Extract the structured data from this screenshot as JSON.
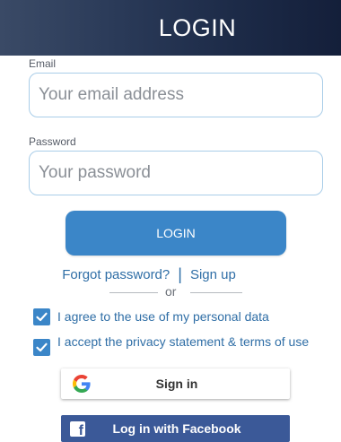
{
  "header": {
    "title": "LOGIN"
  },
  "email": {
    "label": "Email",
    "placeholder": "Your email address",
    "value": ""
  },
  "password": {
    "label": "Password",
    "placeholder": "Your password",
    "value": ""
  },
  "login_button": {
    "label": "LOGIN"
  },
  "links": {
    "forgot": "Forgot password?",
    "separator": "|",
    "signup": "Sign up"
  },
  "divider": {
    "text": "or"
  },
  "consents": [
    {
      "label": "I agree to the use of my personal data",
      "checked": true
    },
    {
      "label": "I accept the privacy statement & terms of use",
      "checked": true
    }
  ],
  "google": {
    "label": "Sign in",
    "icon": "google-g-icon"
  },
  "facebook": {
    "label": "Log in with Facebook",
    "icon": "facebook-f-icon"
  },
  "colors": {
    "header_gradient_start": "#3a4a66",
    "header_gradient_end": "#141f3a",
    "accent": "#3b86c8",
    "link": "#2f6ea6",
    "input_border": "#a9cde8",
    "facebook": "#3b5998"
  }
}
